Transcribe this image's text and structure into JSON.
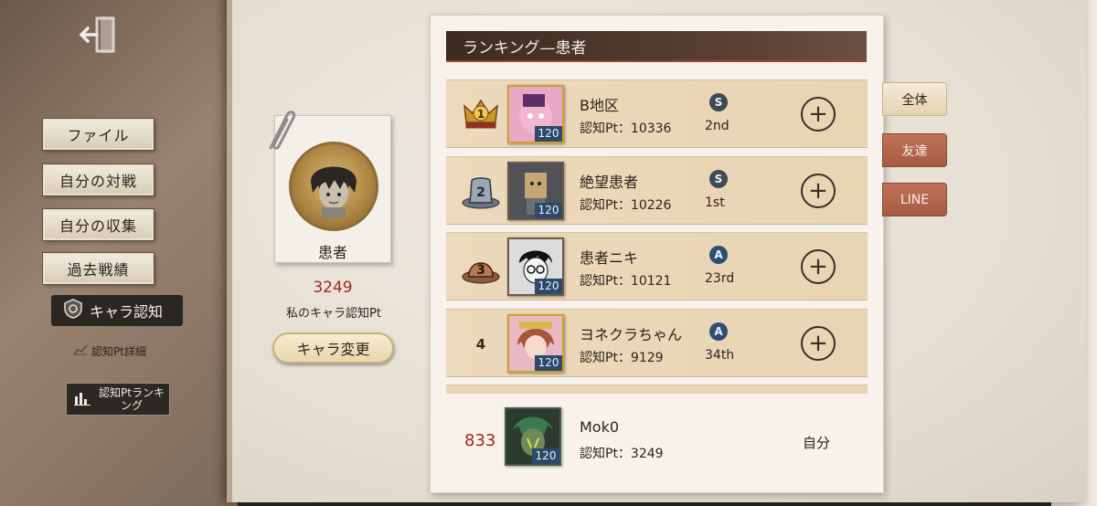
{
  "sidebar": {
    "items": [
      {
        "label": "ファイル"
      },
      {
        "label": "自分の対戦"
      },
      {
        "label": "自分の収集"
      },
      {
        "label": "過去戦績"
      }
    ],
    "active_label": "キャラ認知",
    "sub_label": "認知Pt詳細",
    "ranking_label": "認知Ptランキング"
  },
  "character": {
    "name": "患者",
    "points": "3249",
    "points_label": "私のキャラ認知Pt",
    "change_button": "キャラ変更"
  },
  "ranking": {
    "header": "ランキング—患者",
    "rows": [
      {
        "rank": "1",
        "name": "B地区",
        "pt": "認知Pt：10336",
        "tier": "S",
        "tier_rank": "2nd",
        "level": "120",
        "tier_color": "#3e4a55"
      },
      {
        "rank": "2",
        "name": "絶望患者",
        "pt": "認知Pt：10226",
        "tier": "S",
        "tier_rank": "1st",
        "level": "120",
        "tier_color": "#3e4a55"
      },
      {
        "rank": "3",
        "name": "患者ニキ",
        "pt": "認知Pt：10121",
        "tier": "A",
        "tier_rank": "23rd",
        "level": "120",
        "tier_color": "#2f4d73"
      },
      {
        "rank": "4",
        "name": "ヨネクラちゃん",
        "pt": "認知Pt：9129",
        "tier": "A",
        "tier_rank": "34th",
        "level": "120",
        "tier_color": "#2f4d73"
      }
    ],
    "self": {
      "rank": "833",
      "name": "Mok0",
      "pt": "認知Pt：3249",
      "level": "120",
      "label": "自分"
    }
  },
  "tabs": [
    {
      "label": "全体",
      "active": true
    },
    {
      "label": "友達",
      "active": false
    },
    {
      "label": "LINE",
      "active": false
    }
  ],
  "icons": {
    "exit": "exit-door-icon",
    "add": "plus-icon",
    "crown": "crown-icon"
  }
}
